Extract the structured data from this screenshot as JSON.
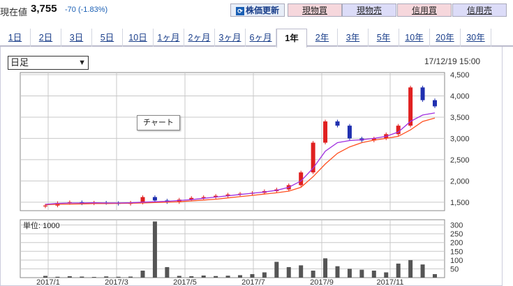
{
  "price": {
    "label": "現在値",
    "value": "3,755",
    "change": "-70 (-1.83%)"
  },
  "toolbar": {
    "refresh": "株価更新",
    "spot_buy": "現物買",
    "spot_sell": "現物売",
    "margin_buy": "信用買",
    "margin_sell": "信用売"
  },
  "tabs": [
    "1日",
    "2日",
    "3日",
    "5日",
    "10日",
    "1ヶ月",
    "2ヶ月",
    "3ヶ月",
    "6ヶ月",
    "1年",
    "2年",
    "3年",
    "5年",
    "10年",
    "20年",
    "30年"
  ],
  "active_tab": "1年",
  "period_select": {
    "value": "日足"
  },
  "timestamp": "17/12/19 15:00",
  "tooltip": "チャート",
  "colors": {
    "up": "#e02020",
    "down": "#2030b0",
    "ma_short": "#a030e0",
    "ma_long": "#ff5020",
    "volume": "#555555",
    "grid": "#c8c8c8"
  },
  "chart_data": {
    "type": "candlestick",
    "price": {
      "ylim": [
        1300,
        4550
      ],
      "yticks": [
        "1,500",
        "2,000",
        "2,500",
        "3,000",
        "3,500",
        "4,000",
        "4,500"
      ],
      "close": [
        1420,
        1480,
        1500,
        1470,
        1490,
        1480,
        1460,
        1490,
        1620,
        1540,
        1500,
        1560,
        1600,
        1620,
        1650,
        1680,
        1700,
        1720,
        1760,
        1800,
        1900,
        2200,
        2900,
        3400,
        3300,
        3000,
        2950,
        3000,
        3100,
        3300,
        4200,
        3900,
        3755
      ],
      "ma_short": [
        1450,
        1470,
        1480,
        1480,
        1485,
        1480,
        1480,
        1485,
        1500,
        1510,
        1520,
        1540,
        1560,
        1590,
        1620,
        1650,
        1680,
        1710,
        1740,
        1780,
        1850,
        2000,
        2300,
        2700,
        2900,
        2950,
        2970,
        3000,
        3050,
        3150,
        3400,
        3550,
        3600
      ],
      "ma_long": [
        1440,
        1450,
        1455,
        1460,
        1465,
        1465,
        1470,
        1475,
        1480,
        1490,
        1500,
        1510,
        1530,
        1550,
        1570,
        1600,
        1630,
        1660,
        1690,
        1720,
        1760,
        1850,
        2100,
        2400,
        2650,
        2800,
        2900,
        2960,
        3000,
        3050,
        3200,
        3400,
        3480
      ]
    },
    "volume": {
      "unit_label": "単位: 1000",
      "ylim": [
        0,
        330
      ],
      "yticks": [
        "300",
        "250",
        "200",
        "150",
        "100",
        "50"
      ],
      "values": [
        10,
        5,
        8,
        6,
        4,
        7,
        5,
        6,
        40,
        320,
        60,
        10,
        8,
        12,
        9,
        11,
        14,
        20,
        30,
        90,
        60,
        70,
        40,
        110,
        65,
        50,
        45,
        40,
        30,
        80,
        100,
        75,
        20
      ]
    },
    "x_labels": [
      "2017/1",
      "2017/3",
      "2017/5",
      "2017/7",
      "2017/9",
      "2017/11"
    ]
  }
}
